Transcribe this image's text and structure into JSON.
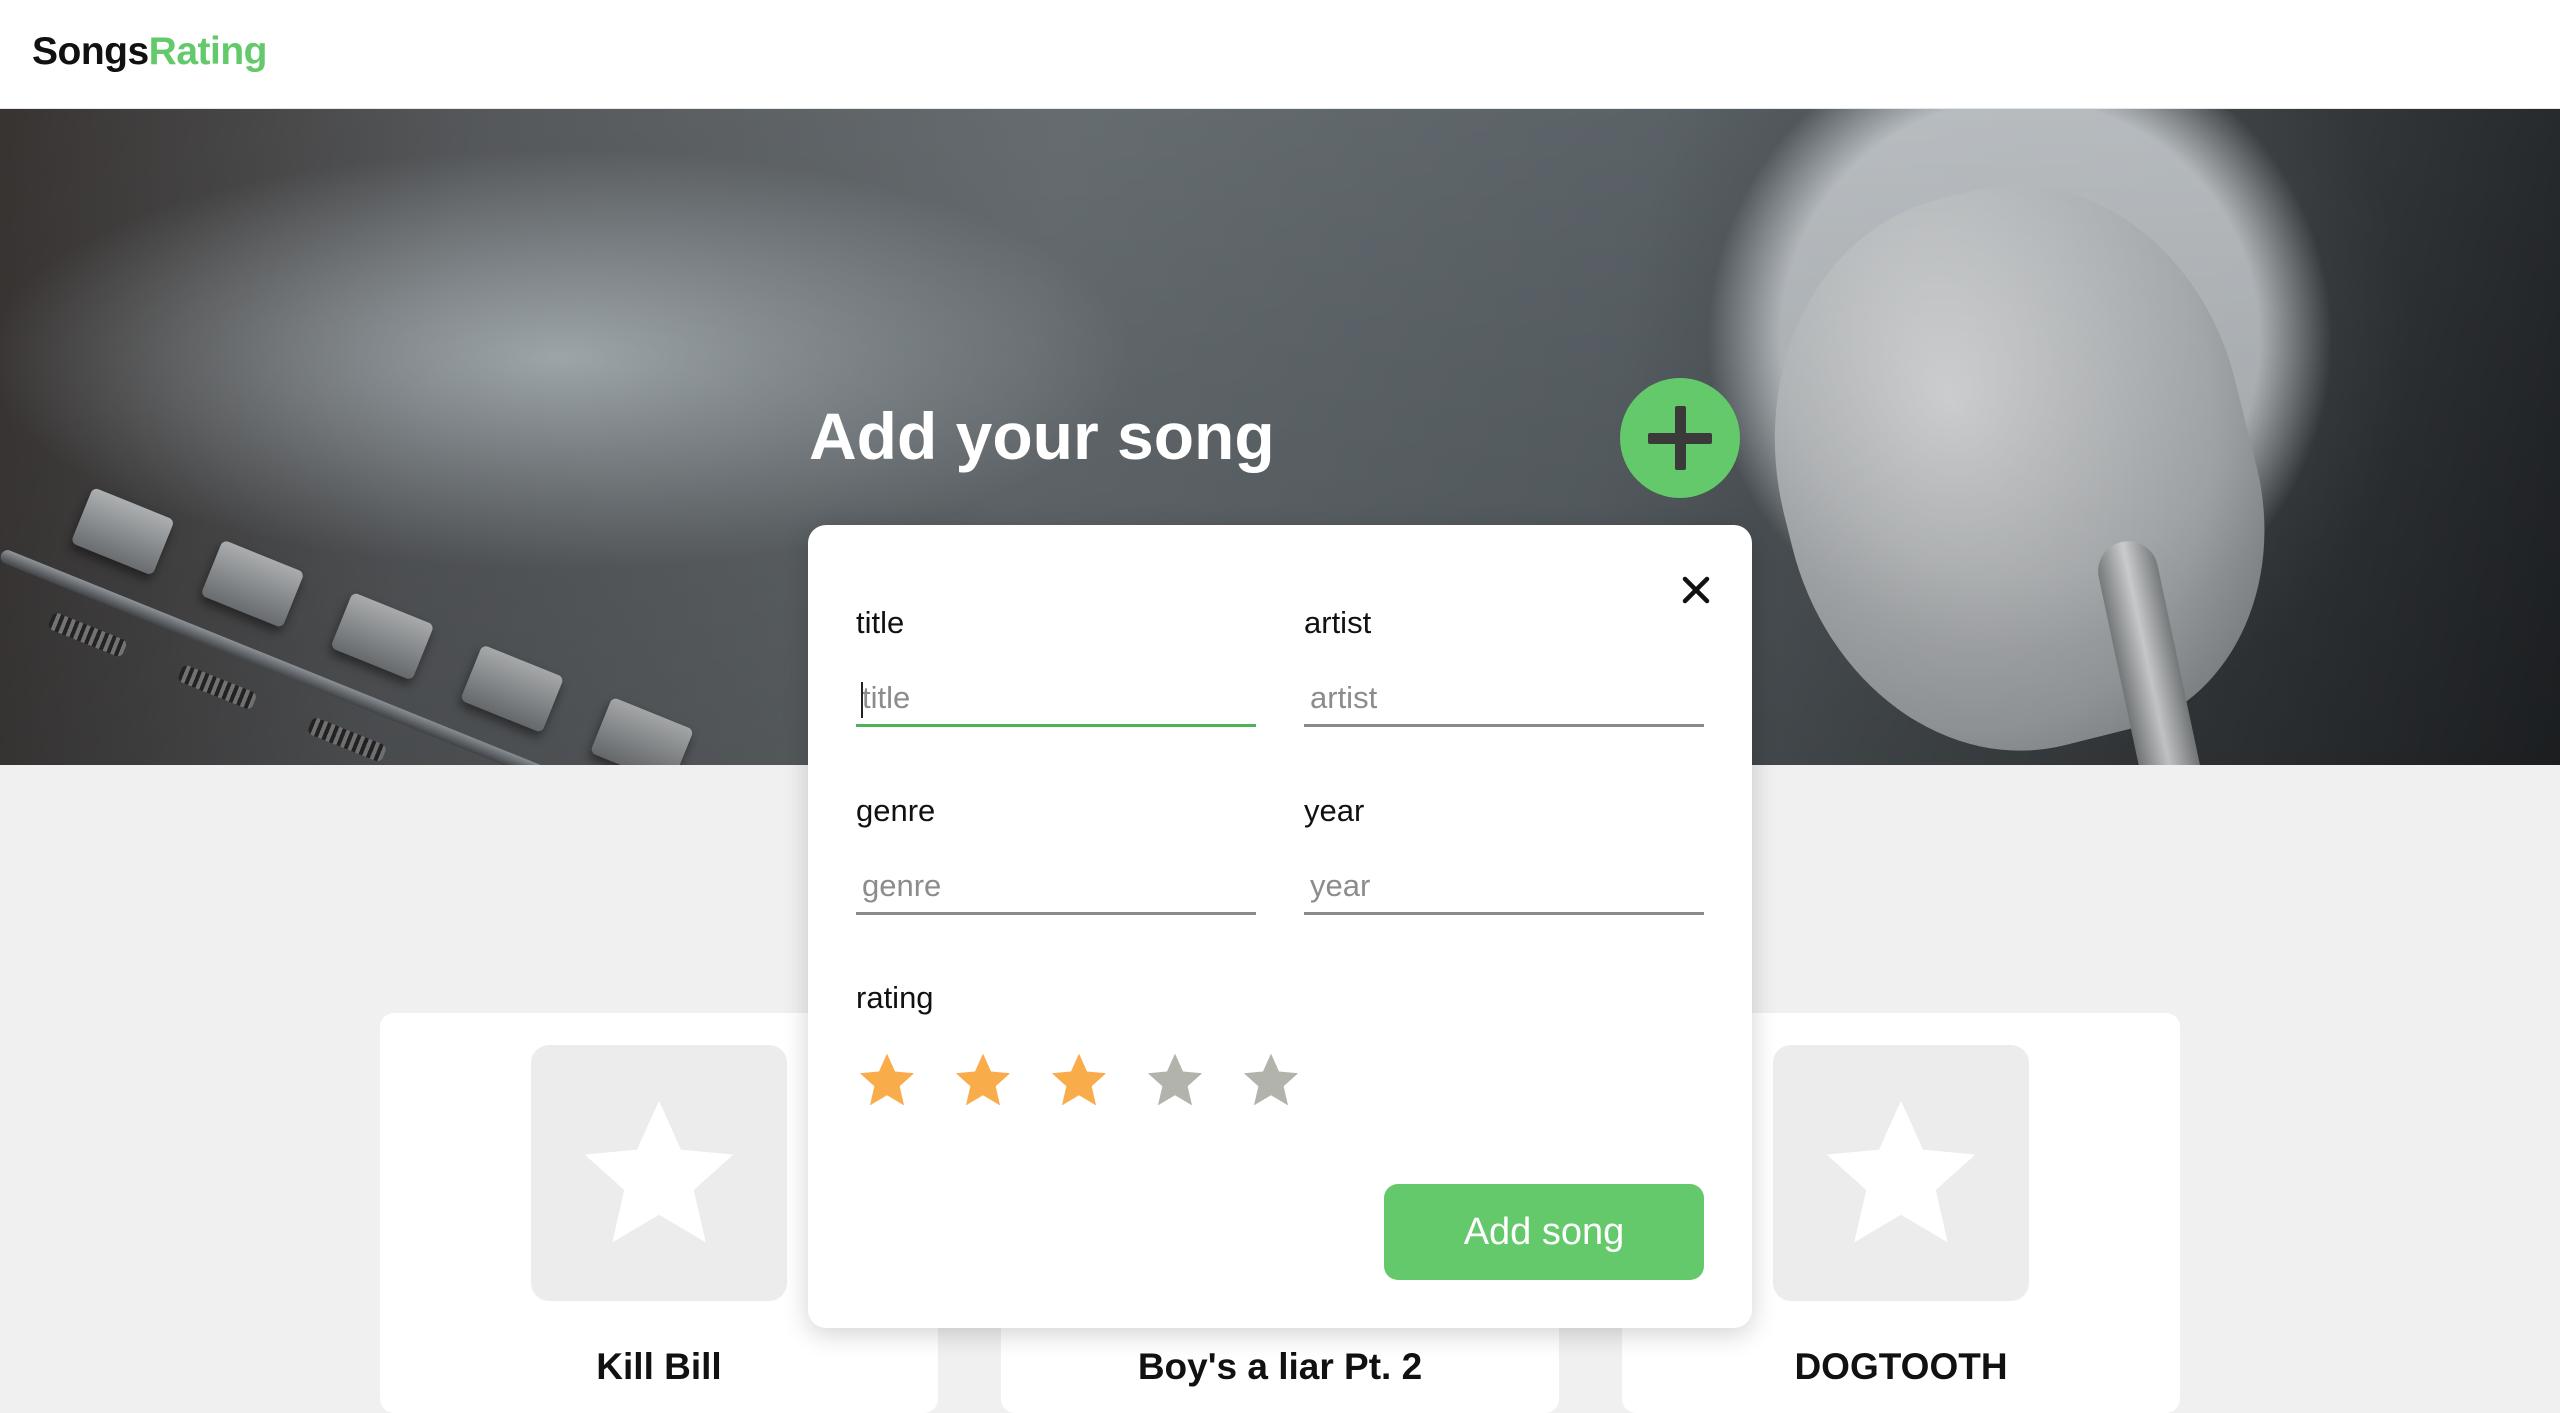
{
  "app": {
    "logo_part1": "Songs",
    "logo_part2": "Rating"
  },
  "hero": {
    "title": "Add your song",
    "add_button_icon": "plus-icon"
  },
  "cards": [
    {
      "title": "Kill Bill",
      "icon": "star-placeholder-icon"
    },
    {
      "title": "Boy's a liar Pt. 2",
      "icon": "star-placeholder-icon"
    },
    {
      "title": "DOGTOOTH",
      "icon": "star-placeholder-icon"
    }
  ],
  "modal": {
    "close_icon": "close-icon",
    "fields": {
      "title": {
        "label": "title",
        "placeholder": "title",
        "value": ""
      },
      "artist": {
        "label": "artist",
        "placeholder": "artist",
        "value": ""
      },
      "genre": {
        "label": "genre",
        "placeholder": "genre",
        "value": ""
      },
      "year": {
        "label": "year",
        "placeholder": "year",
        "value": ""
      }
    },
    "rating": {
      "label": "rating",
      "value": 3,
      "max": 5
    },
    "submit_label": "Add song"
  },
  "colors": {
    "accent": "#63c96b",
    "star_filled": "#f8ac4a",
    "star_empty": "#b3b3ad",
    "focus_underline": "#4cb356"
  }
}
